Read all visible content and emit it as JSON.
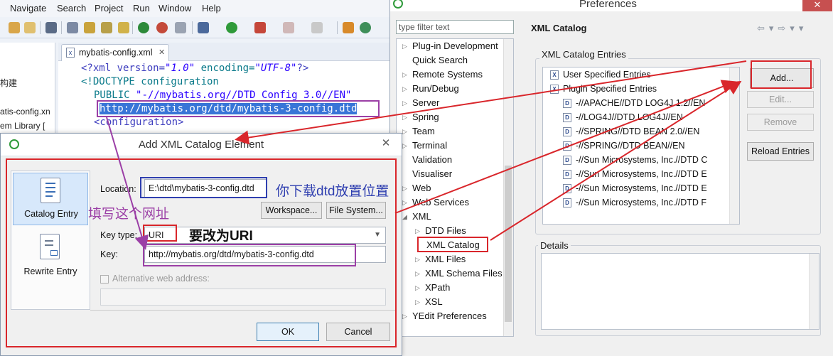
{
  "eclipse": {
    "menu": [
      "Navigate",
      "Search",
      "Project",
      "Run",
      "Window",
      "Help"
    ],
    "left_pane": {
      "partial_label_1": "构建",
      "partial_label_2": "atis-config.xn",
      "partial_label_3": "em Library ["
    },
    "editor": {
      "tab_label": "mybatis-config.xml",
      "tab_close": "✕",
      "lines": {
        "l1_open": "<?xml version=",
        "l1_version": "\"1.0\"",
        "l1_enc_attr": " encoding=",
        "l1_enc": "\"UTF-8\"",
        "l1_close": "?>",
        "l2": "<!DOCTYPE configuration",
        "l3_kw": "PUBLIC ",
        "l3_str": "\"-//mybatis.org//DTD Config 3.0//EN\"",
        "l4_url": "http://mybatis.org/dtd/mybatis-3-config.dtd",
        "l5": "<configuration>"
      }
    }
  },
  "preferences": {
    "window_title": "Preferences",
    "close_glyph": "✕",
    "filter_placeholder": "type filter text",
    "tree": [
      {
        "label": "Plug-in Development",
        "expander": "▷"
      },
      {
        "label": "Quick Search",
        "expander": ""
      },
      {
        "label": "Remote Systems",
        "expander": "▷"
      },
      {
        "label": "Run/Debug",
        "expander": "▷"
      },
      {
        "label": "Server",
        "expander": "▷"
      },
      {
        "label": "Spring",
        "expander": "▷"
      },
      {
        "label": "Team",
        "expander": "▷"
      },
      {
        "label": "Terminal",
        "expander": "▷"
      },
      {
        "label": "Validation",
        "expander": ""
      },
      {
        "label": "Visualiser",
        "expander": ""
      },
      {
        "label": "Web",
        "expander": "▷"
      },
      {
        "label": "Web Services",
        "expander": "▷"
      },
      {
        "label": "XML",
        "expander": "◢"
      },
      {
        "label": "DTD Files",
        "expander": "▷"
      },
      {
        "label": "XML Catalog",
        "expander": ""
      },
      {
        "label": "XML Files",
        "expander": "▷"
      },
      {
        "label": "XML Schema Files",
        "expander": "▷"
      },
      {
        "label": "XPath",
        "expander": "▷"
      },
      {
        "label": "XSL",
        "expander": "▷"
      },
      {
        "label": "YEdit Preferences",
        "expander": "▷"
      }
    ],
    "pane_title": "XML Catalog",
    "nav_glyphs": "⇦▾⇨▾▾",
    "entries_group_label": "XML Catalog Entries",
    "entries": [
      "User Specified Entries",
      "Plugin Specified Entries",
      "-//APACHE//DTD LOG4J 1.2//EN",
      "-//LOG4J//DTD LOG4J//EN",
      "-//SPRING//DTD BEAN 2.0//EN",
      "-//SPRING//DTD BEAN//EN",
      "-//Sun Microsystems, Inc.//DTD C",
      "-//Sun Microsystems, Inc.//DTD E",
      "-//Sun Microsystems, Inc.//DTD E",
      "-//Sun Microsystems, Inc.//DTD F"
    ],
    "buttons": {
      "add": "Add...",
      "edit": "Edit...",
      "remove": "Remove",
      "reload": "Reload Entries"
    },
    "details_label": "Details"
  },
  "dialog": {
    "title": "Add XML Catalog Element",
    "close_glyph": "✕",
    "side": {
      "catalog_entry": "Catalog Entry",
      "rewrite_entry": "Rewrite Entry"
    },
    "location_label": "Location:",
    "location_value": "E:\\dtd\\mybatis-3-config.dtd",
    "workspace_button": "Workspace...",
    "filesystem_button": "File System...",
    "key_type_label": "Key type:",
    "key_type_value": "URI",
    "key_label": "Key:",
    "key_value": "http://mybatis.org/dtd/mybatis-3-config.dtd",
    "alt_web_label": "Alternative web address:",
    "ok_button": "OK",
    "cancel_button": "Cancel"
  },
  "annotations": {
    "download_location": "你下载dtd放置位置",
    "fill_url": "填写这个网址",
    "change_to_uri": "要改为URI"
  },
  "colors": {
    "annotation_red": "#d9262b",
    "annotation_blue": "#2f3fb0",
    "annotation_purple": "#9b3fa6",
    "selection_blue": "#3875d7",
    "code_purple": "#3f3fbf",
    "code_teal": "#0a7a8a",
    "code_string": "#2a00ff"
  }
}
